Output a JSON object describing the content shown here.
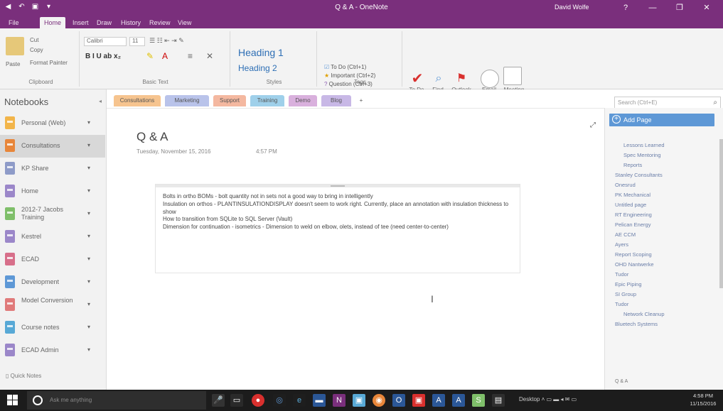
{
  "window": {
    "title": "Q & A - OneNote",
    "user": "David Wolfe",
    "controls": [
      "?",
      "—",
      "❐",
      "✕"
    ]
  },
  "ribbon_tabs": [
    {
      "label": "File"
    },
    {
      "label": "Home",
      "active": true
    },
    {
      "label": "Insert"
    },
    {
      "label": "Draw"
    },
    {
      "label": "History"
    },
    {
      "label": "Review"
    },
    {
      "label": "View"
    }
  ],
  "ribbon": {
    "clipboard": {
      "paste": "Paste",
      "cut": "Cut",
      "copy": "Copy",
      "format_painter": "Format Painter",
      "label": "Clipboard"
    },
    "basic_text": {
      "font": "Calibri",
      "size": "11",
      "label": "Basic Text"
    },
    "styles": {
      "heading1": "Heading 1",
      "heading2": "Heading 2",
      "label": "Styles"
    },
    "tags": {
      "todo": "To Do (Ctrl+1)",
      "important": "Important (Ctrl+2)",
      "question": "Question (Ctrl+3)",
      "label": "Tags"
    },
    "todo_tag": "To Do Tag",
    "find_tags": "Find Tags",
    "outlook_tasks": "Outlook Tasks",
    "email_page": "Email Page",
    "meeting_details": "Meeting Details",
    "email_label": "Email",
    "meetings_label": "Meetings"
  },
  "notebooks": {
    "header": "Notebooks",
    "items": [
      {
        "label": "Personal (Web)",
        "color": "#f2b54a"
      },
      {
        "label": "Consultations",
        "color": "#e8863a",
        "selected": true
      },
      {
        "label": "KP Share",
        "color": "#8e9bc8"
      },
      {
        "label": "Home",
        "color": "#9b87c9"
      },
      {
        "label": "2012-7 Jacobs Training",
        "color": "#7fbf6a"
      },
      {
        "label": "Kestrel",
        "color": "#9b87c9"
      },
      {
        "label": "ECAD",
        "color": "#d76f8a"
      },
      {
        "label": "Development",
        "color": "#5e98d6"
      },
      {
        "label": "Model Conversion",
        "color": "#e07a7a"
      },
      {
        "label": "Course notes",
        "color": "#58a9d6"
      },
      {
        "label": "ECAD Admin",
        "color": "#9b87c9"
      }
    ],
    "quick_notes": "Quick Notes"
  },
  "sections": [
    {
      "label": "Consultations",
      "color": "#f6c48f",
      "active": true
    },
    {
      "label": "Marketing",
      "color": "#b9c3ea"
    },
    {
      "label": "Support",
      "color": "#f4b8a0"
    },
    {
      "label": "Training",
      "color": "#9fd0ea"
    },
    {
      "label": "Demo",
      "color": "#d9b0dd"
    },
    {
      "label": "Blog",
      "color": "#c8b8e6"
    },
    {
      "label": "+",
      "color": "#ffffff"
    }
  ],
  "search": {
    "placeholder": "Search (Ctrl+E)"
  },
  "page": {
    "title": "Q & A",
    "date": "Tuesday, November 15, 2016",
    "time": "4:57 PM",
    "note_lines": [
      "Bolts in ortho BOMs - bolt quantity not in sets not a good way to bring in intelligently",
      "Insulation on orthos - PLANTINSULATIONDISPLAY doesn't seem to work right. Currently, place an annotation with insulation thickness to show",
      "How to transition from SQLite to SQL Server (Vault)",
      "Dimension for continuation - isometrics - Dimension to weld on elbow, olets, instead of tee (need center-to-center)"
    ]
  },
  "pages": {
    "add_page": "Add Page",
    "items": [
      {
        "label": "Lessons Learned",
        "indent": 1
      },
      {
        "label": "Spec Mentoring",
        "indent": 1
      },
      {
        "label": "Reports",
        "indent": 1
      },
      {
        "label": "Stanley Consultants",
        "indent": 0
      },
      {
        "label": "Onesrud",
        "indent": 0
      },
      {
        "label": "PK Mechanical",
        "indent": 0
      },
      {
        "label": "Untitled page",
        "indent": 0
      },
      {
        "label": "RT Engineering",
        "indent": 0
      },
      {
        "label": "Pelican Energy",
        "indent": 0
      },
      {
        "label": "AE CCM",
        "indent": 0
      },
      {
        "label": "Ayers",
        "indent": 0
      },
      {
        "label": "Report Scoping",
        "indent": 0
      },
      {
        "label": "OHD Nantwerke",
        "indent": 0
      },
      {
        "label": "Tudor",
        "indent": 0
      },
      {
        "label": "Epic Piping",
        "indent": 0
      },
      {
        "label": "SI Group",
        "indent": 0
      },
      {
        "label": "Tudor",
        "indent": 0
      },
      {
        "label": "Network Cleanup",
        "indent": 1
      },
      {
        "label": "Bluetech Systems",
        "indent": 0
      }
    ],
    "footer": "Q & A"
  },
  "taskbar": {
    "search_placeholder": "Ask me anything",
    "tray_label": "Desktop",
    "time": "4:58 PM",
    "date": "11/15/2016"
  }
}
